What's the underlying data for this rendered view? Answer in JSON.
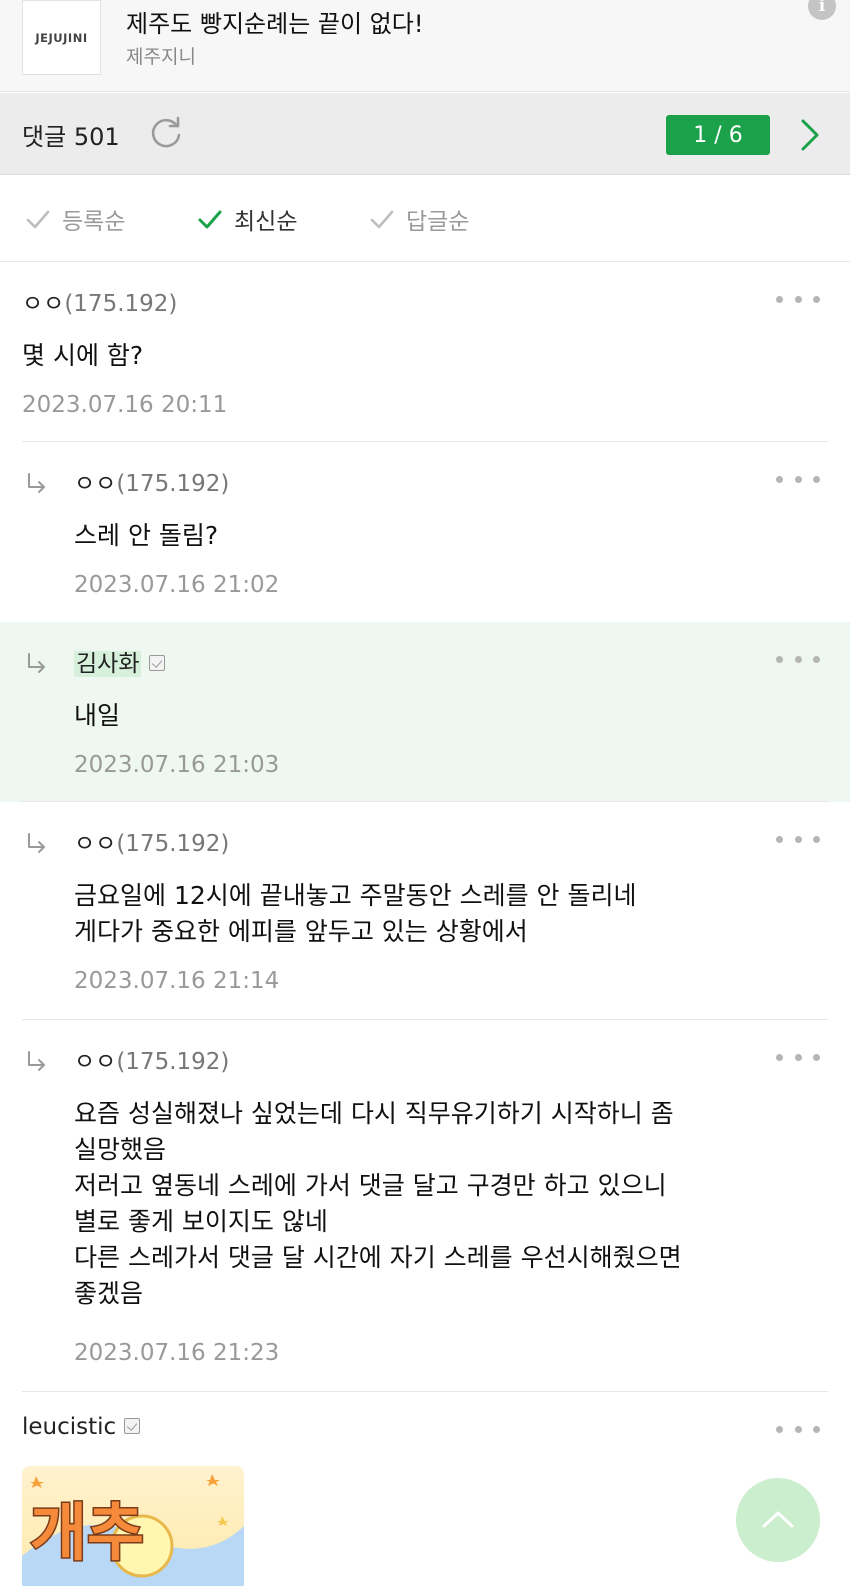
{
  "post": {
    "logo_text": "JEJUJINI",
    "title": "제주도 빵지순례는 끝이 없다!",
    "gallery": "제주지니"
  },
  "comment_bar": {
    "label": "댓글",
    "count": "501",
    "page_current": "1",
    "page_total": "6",
    "page_sep": " / "
  },
  "sort_tabs": [
    {
      "label": "등록순",
      "active": false
    },
    {
      "label": "최신순",
      "active": true
    },
    {
      "label": "답글순",
      "active": false
    }
  ],
  "comments": [
    {
      "nick": "ㅇㅇ",
      "ip": "(175.192)",
      "reply": false,
      "text": "몇 시에 함?",
      "date": "2023.07.16 20:11"
    },
    {
      "nick": "ㅇㅇ",
      "ip": "(175.192)",
      "reply": true,
      "text": "스레 안 돌림?",
      "date": "2023.07.16 21:02"
    },
    {
      "nick": "김사화",
      "ip": "",
      "reply": true,
      "text": "내일",
      "date": "2023.07.16 21:03"
    },
    {
      "nick": "ㅇㅇ",
      "ip": "(175.192)",
      "reply": true,
      "text": "금요일에 12시에 끝내놓고 주말동안 스레를 안 돌리네\n게다가 중요한 에피를 앞두고 있는 상황에서",
      "date": "2023.07.16 21:14"
    },
    {
      "nick": "ㅇㅇ",
      "ip": "(175.192)",
      "reply": true,
      "text": "요즘 성실해졌나 싶었는데 다시 직무유기하기 시작하니 좀\n실망했음\n저러고 옆동네 스레에 가서 댓글 달고 구경만 하고 있으니\n별로 좋게 보이지도 않네\n다른 스레가서 댓글 달 시간에 자기 스레를 우선시해줬으면\n좋겠음",
      "date": "2023.07.16 21:23"
    },
    {
      "nick": "leucistic",
      "ip": "",
      "reply": false,
      "text": "",
      "date": ""
    }
  ],
  "dccon_text": "개추",
  "colors": {
    "accent_green": "#1aa14a",
    "highlight_bg": "#eef7f0",
    "scroll_btn": "#cbeecf"
  }
}
